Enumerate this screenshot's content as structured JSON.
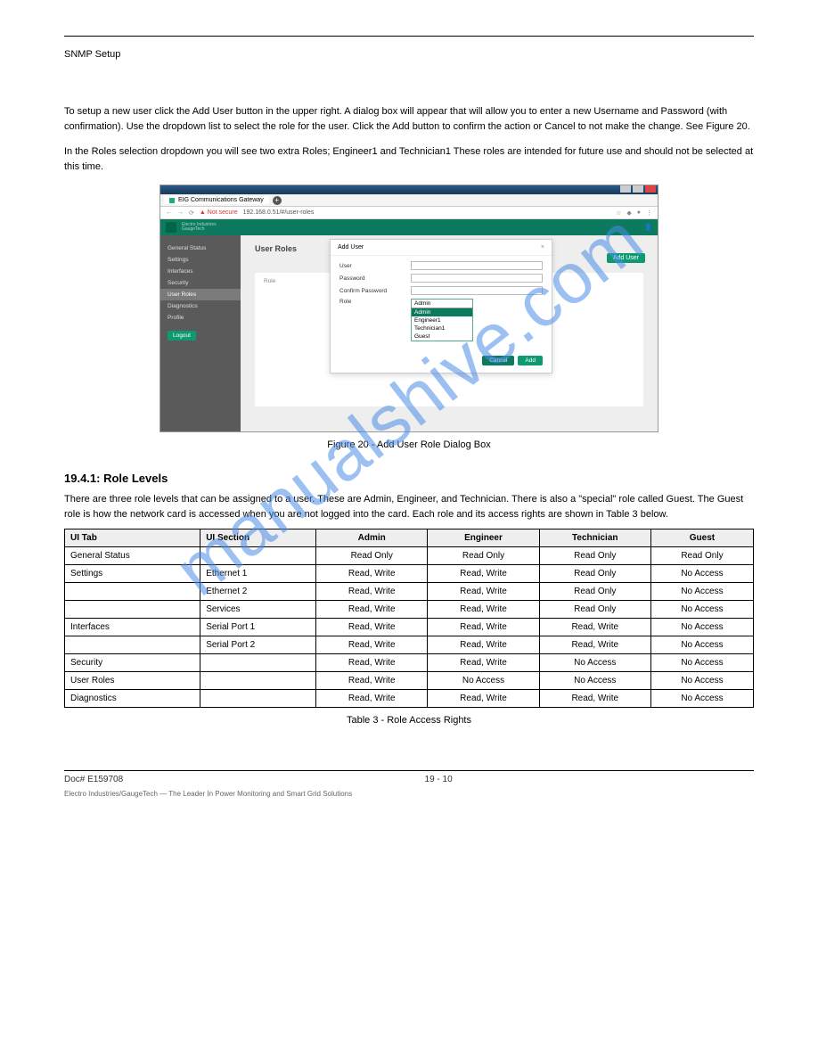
{
  "watermark": "manualshive.com",
  "header": {
    "left": "SNMP Setup",
    "right": ""
  },
  "intro1": "To setup a new user click the Add User button in the upper right. A dialog box will appear that will allow you to enter a new Username and Password (with confirmation). Use the dropdown list to select the role for the user. Click the Add button to confirm the action or Cancel to not make the change. See Figure 20.",
  "intro2": "In the Roles selection dropdown you will see two extra Roles; Engineer1 and Technician1 These roles are intended for future use and should not be selected at this time.",
  "figcap": "Figure 20 - Add User Role Dialog Box",
  "screenshot": {
    "tab_title": "EIG Communications Gateway",
    "not_secure": "Not secure",
    "url": "192.168.0.51/#/user-roles",
    "brand1": "Electro Industries",
    "brand2": "GaugeTech",
    "sidebar": {
      "items": [
        "General Status",
        "Settings",
        "Interfaces",
        "Security",
        "User Roles",
        "Diagnostics",
        "Profile"
      ],
      "active_index": 4,
      "logout": "Logout"
    },
    "page_title": "User Roles",
    "table_col": "Role",
    "add_user_btn": "Add User",
    "modal": {
      "title": "Add User",
      "user_lbl": "User",
      "pwd_lbl": "Password",
      "cpwd_lbl": "Confirm Password",
      "role_lbl": "Role",
      "role_opts": [
        "Admin",
        "Admin",
        "Engineer1",
        "Technician1",
        "Guest"
      ],
      "cancel": "Cancel",
      "add": "Add"
    }
  },
  "section_head": "19.4.1: Role Levels",
  "section_desc": "There are three role levels that can be assigned to a user. These are Admin, Engineer, and Technician. There is also a \"special\" role called Guest. The Guest role is how the network card is accessed when you are not logged into the card. Each role and its access rights are shown in Table 3 below.",
  "table": {
    "headers": [
      "UI Tab",
      "UI Section",
      "Admin",
      "Engineer",
      "Technician",
      "Guest"
    ],
    "rows": [
      [
        "General Status",
        "",
        "Read Only",
        "Read Only",
        "Read Only",
        "Read Only"
      ],
      [
        "Settings",
        "Ethernet 1",
        "Read, Write",
        "Read, Write",
        "Read Only",
        "No Access"
      ],
      [
        "",
        "Ethernet 2",
        "Read, Write",
        "Read, Write",
        "Read Only",
        "No Access"
      ],
      [
        "",
        "Services",
        "Read, Write",
        "Read, Write",
        "Read Only",
        "No Access"
      ],
      [
        "Interfaces",
        "Serial Port 1",
        "Read, Write",
        "Read, Write",
        "Read, Write",
        "No Access"
      ],
      [
        "",
        "Serial Port 2",
        "Read, Write",
        "Read, Write",
        "Read, Write",
        "No Access"
      ],
      [
        "Security",
        "",
        "Read, Write",
        "Read, Write",
        "No Access",
        "No Access"
      ],
      [
        "User Roles",
        "",
        "Read, Write",
        "No Access",
        "No Access",
        "No Access"
      ],
      [
        "Diagnostics",
        "",
        "Read, Write",
        "Read, Write",
        "Read, Write",
        "No Access"
      ]
    ]
  },
  "table_cap": "Table 3 - Role Access Rights",
  "footer": {
    "left": "Doc# E159708",
    "mid": "19 - 10",
    "right": ""
  },
  "footnote": "Electro Industries/GaugeTech — The Leader In Power Monitoring and Smart Grid Solutions"
}
